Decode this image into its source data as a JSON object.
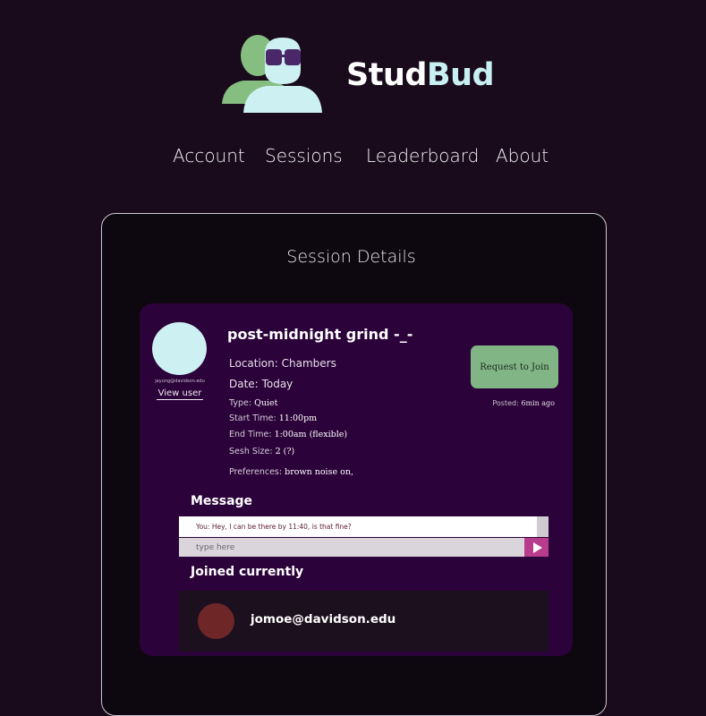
{
  "brand": {
    "part1": "Stud",
    "part2": "Bud"
  },
  "nav": {
    "account": "Account",
    "sessions": "Sessions",
    "leaderboard": "Leaderboard",
    "about": "About"
  },
  "panel": {
    "title": "Session Details"
  },
  "session": {
    "title": "post-midnight grind  -_-",
    "poster_email": "jayung@davidson.edu",
    "view_user": "View user",
    "location_label": "Location:",
    "location": "Chambers",
    "date_label": "Date:",
    "date": "Today",
    "type_label": "Type:",
    "type": "Quiet",
    "start_label": "Start Time:",
    "start": "11:00pm",
    "end_label": "End Time:",
    "end": "1:00am (flexible)",
    "size_label": "Sesh Size:",
    "size": "2 (?)",
    "prefs_label": "Preferences:",
    "prefs": "brown noise on,",
    "join_button": "Request to Join",
    "posted_label": "Posted:",
    "posted": "6min ago"
  },
  "message": {
    "heading": "Message",
    "last": "You: Hey, I can be there by 11:40, is that fine?",
    "placeholder": "type here"
  },
  "joined": {
    "heading": "Joined currently",
    "members": [
      {
        "email": "jomoe@davidson.edu"
      }
    ]
  },
  "colors": {
    "background": "#190b1b",
    "card": "#2b0239",
    "accent_green": "#82b586",
    "accent_cyan": "#c8eff2",
    "send_button": "#b83c8c"
  },
  "icons": {
    "logo": "two-people-with-sunglasses-logo",
    "send": "play-send-icon"
  }
}
